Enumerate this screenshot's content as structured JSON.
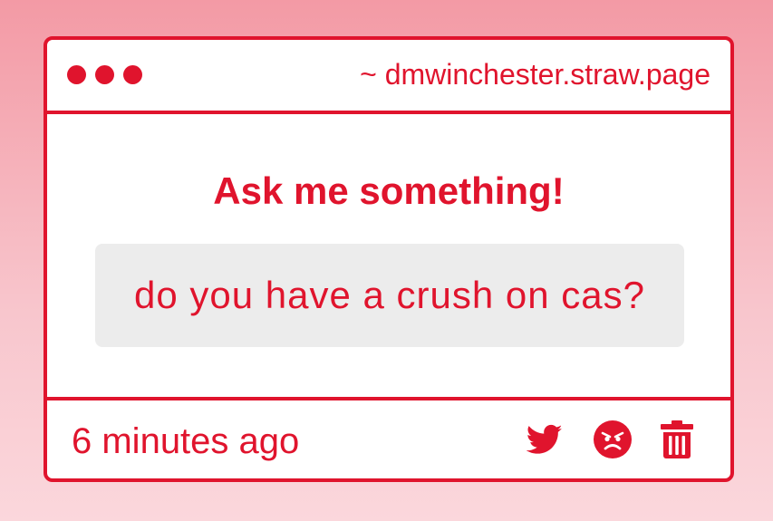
{
  "window": {
    "url": "~ dmwinchester.straw.page"
  },
  "main": {
    "heading": "Ask me something!",
    "question": "do you have a crush on cas?"
  },
  "footer": {
    "timestamp": "6 minutes ago",
    "icons": [
      "twitter-icon",
      "angry-face-icon",
      "trash-icon"
    ]
  },
  "colors": {
    "accent": "#e0142d",
    "question_bg": "#ececec"
  }
}
